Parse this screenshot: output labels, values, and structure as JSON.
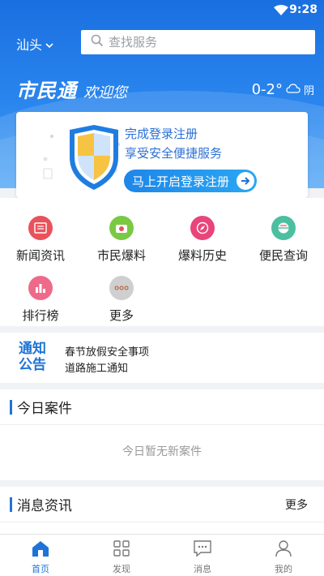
{
  "status_bar": {
    "time": "9:28"
  },
  "header": {
    "city": "汕头",
    "search_placeholder": "查找服务",
    "brand_title": "市民通",
    "brand_welcome": "欢迎您",
    "temperature": "0-2°",
    "weather": "阴"
  },
  "login_card": {
    "line1": "完成登录注册",
    "line2": "享受安全便捷服务",
    "button_label": "马上开启登录注册"
  },
  "quick_grid": {
    "items": [
      {
        "label": "新闻资讯",
        "icon": "newspaper-icon",
        "color": "#e9525b"
      },
      {
        "label": "市民爆料",
        "icon": "camera-icon",
        "color": "#7ac943"
      },
      {
        "label": "爆料历史",
        "icon": "compass-icon",
        "color": "#e8457b"
      },
      {
        "label": "便民查询",
        "icon": "globe-icon",
        "color": "#4bbfa0"
      },
      {
        "label": "排行榜",
        "icon": "ranking-icon",
        "color": "#ee6a8a"
      },
      {
        "label": "更多",
        "icon": "more-dots-icon",
        "color": "#cfcfcf"
      }
    ]
  },
  "notice": {
    "tag_line1": "通知",
    "tag_line2": "公告",
    "items": [
      "春节放假安全事项",
      "道路施工通知"
    ]
  },
  "today_cases": {
    "title": "今日案件",
    "empty_text": "今日暂无新案件"
  },
  "news": {
    "title": "消息资讯",
    "more_label": "更多"
  },
  "tabbar": {
    "tabs": [
      {
        "label": "首页",
        "icon": "home-icon",
        "active": true
      },
      {
        "label": "发现",
        "icon": "grid-icon",
        "active": false
      },
      {
        "label": "消息",
        "icon": "chat-icon",
        "active": false
      },
      {
        "label": "我的",
        "icon": "user-icon",
        "active": false
      }
    ]
  },
  "colors": {
    "primary": "#1e74d6",
    "hero_top": "#1a6fe0",
    "hero_bottom": "#4aa3f5"
  }
}
